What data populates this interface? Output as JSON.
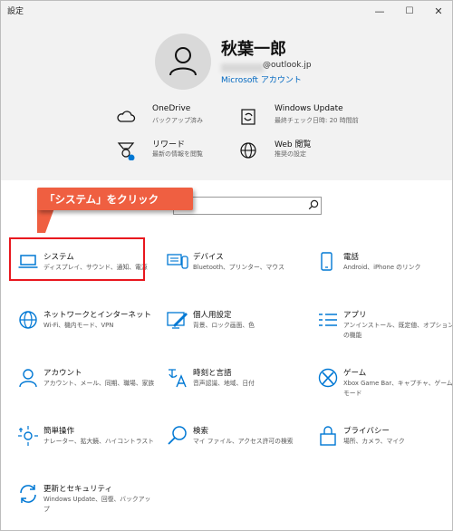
{
  "window": {
    "title": "設定",
    "minimize": "—",
    "maximize": "☐",
    "close": "✕"
  },
  "account": {
    "name": "秋葉一郎",
    "email": "@outlook.jp",
    "link": "Microsoft アカウント"
  },
  "header_items": [
    {
      "icon": "cloud-icon",
      "title": "OneDrive",
      "subtitle": "バックアップ済み"
    },
    {
      "icon": "update-icon",
      "title": "Windows Update",
      "subtitle": "最終チェック日時: 20 時間前"
    },
    {
      "icon": "rewards-icon",
      "title": "リワード",
      "subtitle": "最新の情報を閲覧"
    },
    {
      "icon": "globe-icon",
      "title": "Web 閲覧",
      "subtitle": "推奨の設定"
    }
  ],
  "callout": "「システム」をクリック",
  "tiles": [
    {
      "icon": "laptop-icon",
      "title": "システム",
      "subtitle": "ディスプレイ、サウンド、通知、電源"
    },
    {
      "icon": "devices-icon",
      "title": "デバイス",
      "subtitle": "Bluetooth、プリンター、マウス"
    },
    {
      "icon": "phone-icon",
      "title": "電話",
      "subtitle": "Android、iPhone のリンク"
    },
    {
      "icon": "network-icon",
      "title": "ネットワークとインターネット",
      "subtitle": "Wi-Fi、機内モード、VPN"
    },
    {
      "icon": "personalization-icon",
      "title": "個人用設定",
      "subtitle": "背景、ロック画面、色"
    },
    {
      "icon": "apps-icon",
      "title": "アプリ",
      "subtitle": "アンインストール、既定値、オプションの機能"
    },
    {
      "icon": "person-icon",
      "title": "アカウント",
      "subtitle": "アカウント、メール、同期、職場、家族"
    },
    {
      "icon": "time-language-icon",
      "title": "時刻と言語",
      "subtitle": "音声認識、地域、日付"
    },
    {
      "icon": "xbox-icon",
      "title": "ゲーム",
      "subtitle": "Xbox Game Bar、キャプチャ、ゲーム モード"
    },
    {
      "icon": "accessibility-icon",
      "title": "簡単操作",
      "subtitle": "ナレーター、拡大鏡、ハイコントラスト"
    },
    {
      "icon": "search-icon",
      "title": "検索",
      "subtitle": "マイ ファイル、アクセス許可の検索"
    },
    {
      "icon": "lock-icon",
      "title": "プライバシー",
      "subtitle": "場所、カメラ、マイク"
    },
    {
      "icon": "sync-icon",
      "title": "更新とセキュリティ",
      "subtitle": "Windows Update、回復、バックアップ"
    }
  ]
}
